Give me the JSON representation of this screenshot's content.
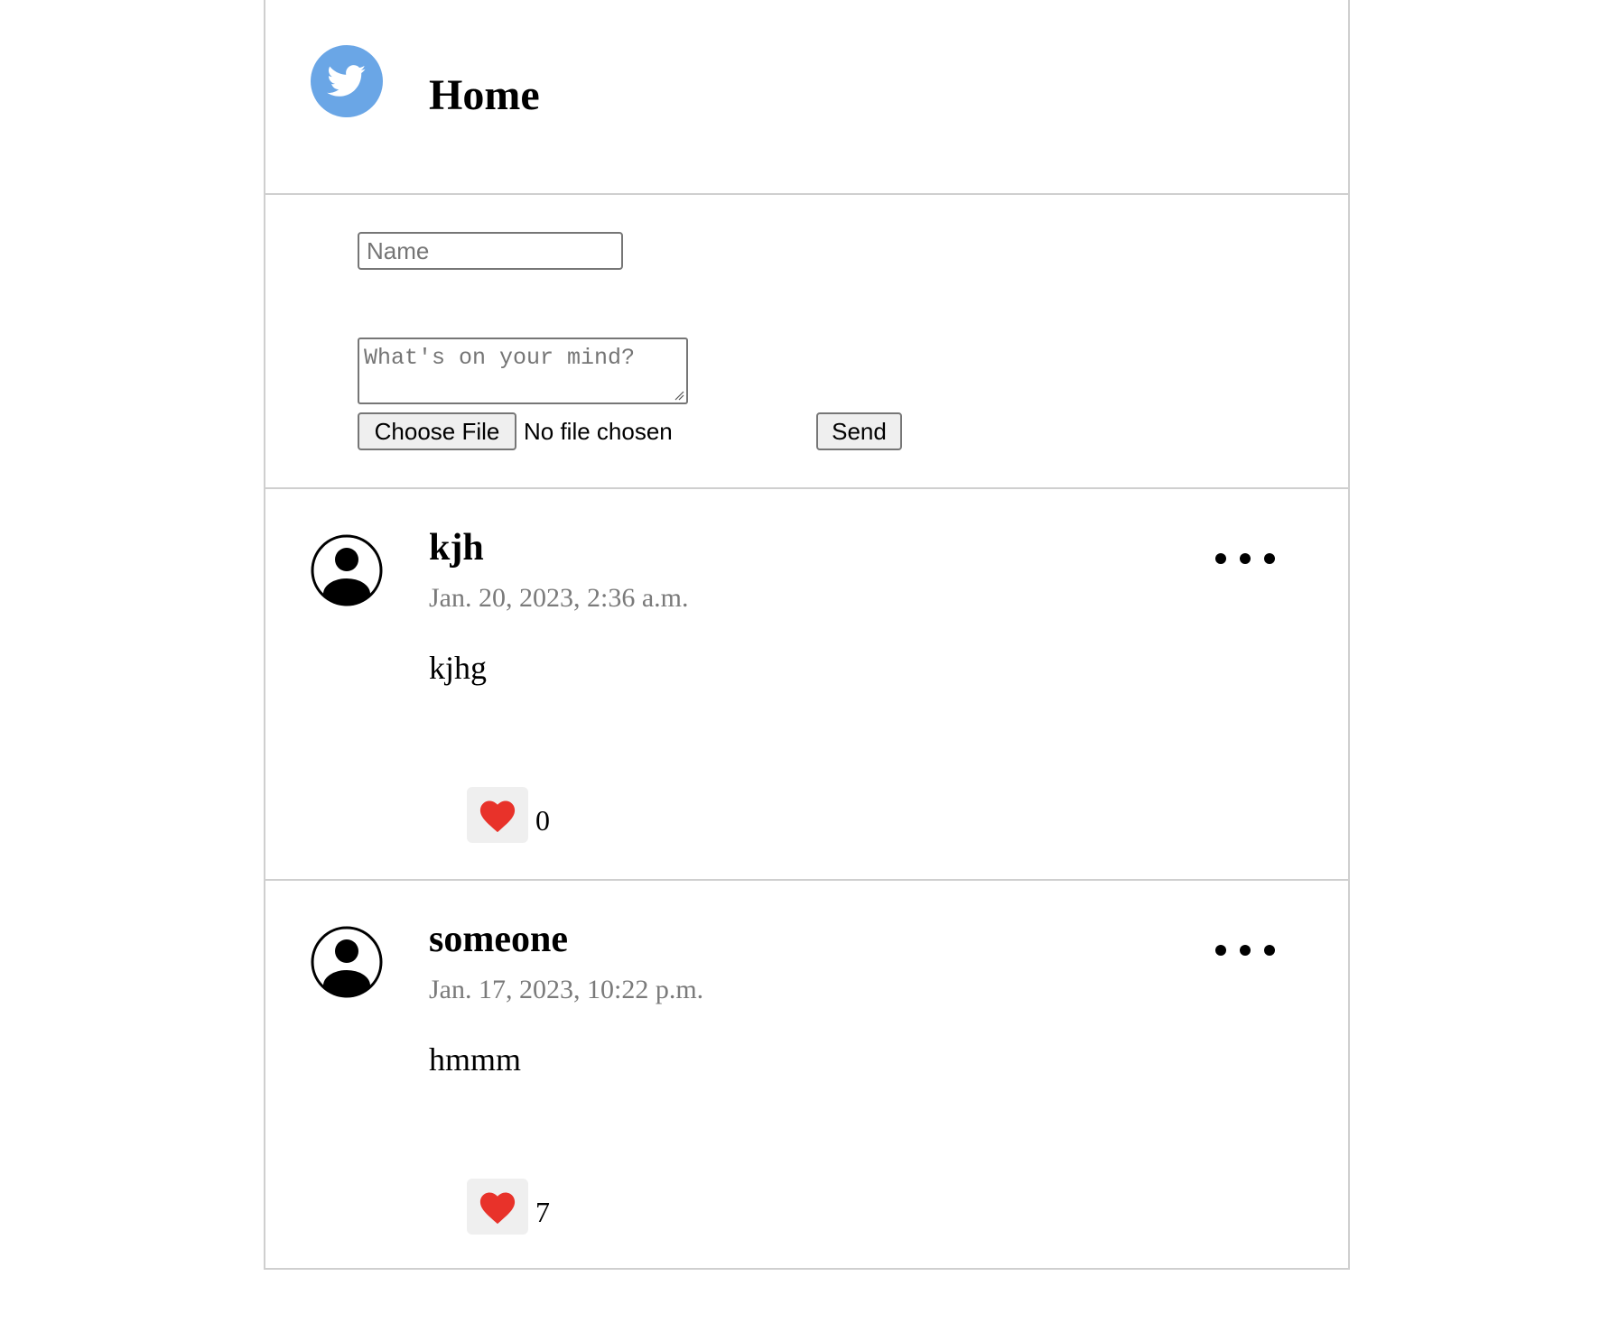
{
  "header": {
    "title": "Home",
    "logo_icon": "twitter-bird-icon",
    "logo_color": "#6aa6e6"
  },
  "composer": {
    "name_placeholder": "Name",
    "name_value": "",
    "text_placeholder": "What's on your mind?",
    "text_value": "",
    "choose_file_label": "Choose File",
    "file_status": "No file chosen",
    "send_label": "Send"
  },
  "posts": [
    {
      "name": "kjh",
      "date": "Jan. 20, 2023, 2:36 a.m.",
      "body": "kjhg",
      "likes": "0",
      "avatar_icon": "user-avatar-icon",
      "menu_icon": "more-options-icon",
      "like_icon": "heart-icon"
    },
    {
      "name": "someone",
      "date": "Jan. 17, 2023, 10:22 p.m.",
      "body": "hmmm",
      "likes": "7",
      "avatar_icon": "user-avatar-icon",
      "menu_icon": "more-options-icon",
      "like_icon": "heart-icon"
    }
  ],
  "colors": {
    "heart": "#e8322a",
    "date_text": "#7a7a7a",
    "border": "#cfcfcf"
  }
}
